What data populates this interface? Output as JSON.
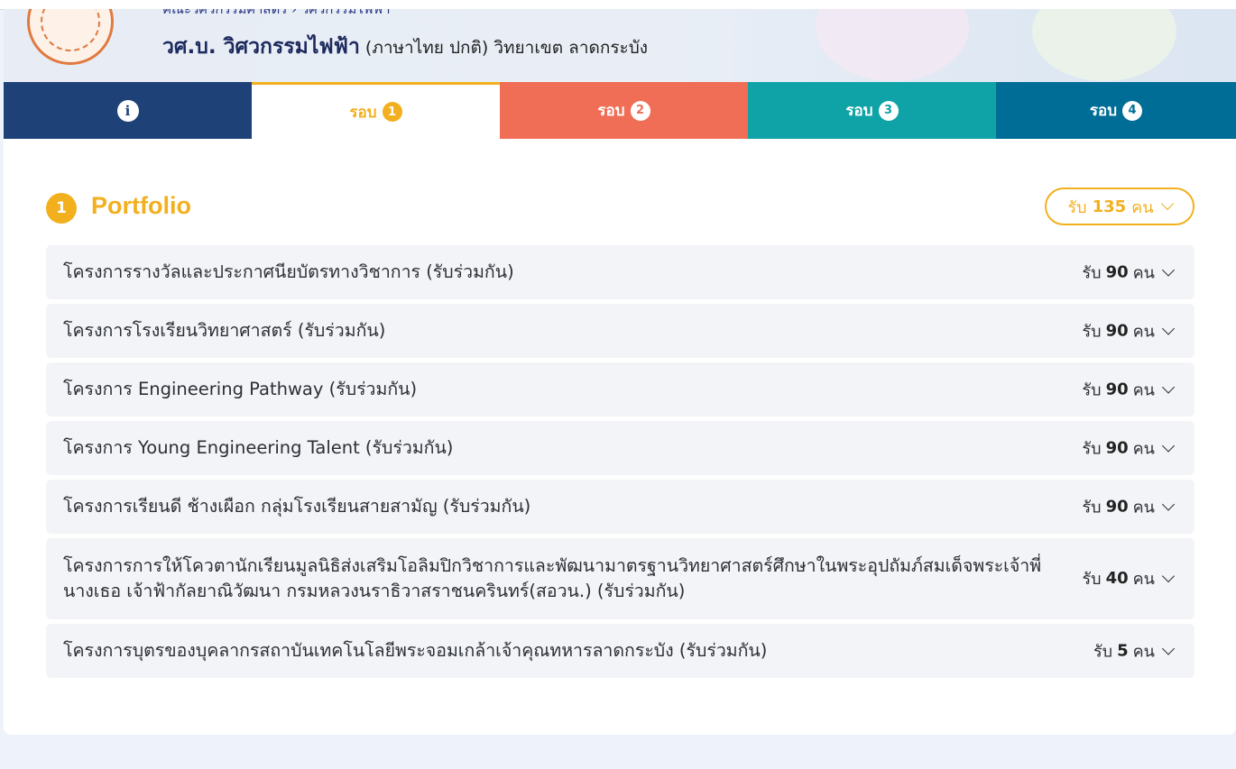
{
  "header": {
    "breadcrumb": "คณะวิศวกรรมศาสตร์ › วิศวกรรมไฟฟ้า",
    "program_bold": "วศ.บ. วิศวกรรมไฟฟ้า",
    "program_rest": " (ภาษาไทย ปกติ) วิทยาเขต ลาดกระบัง"
  },
  "tabs": [
    {
      "label": "",
      "icon": "info-icon"
    },
    {
      "label": "รอบ",
      "num": "1"
    },
    {
      "label": "รอบ",
      "num": "2"
    },
    {
      "label": "รอบ",
      "num": "3"
    },
    {
      "label": "รอบ",
      "num": "4"
    }
  ],
  "section": {
    "number": "1",
    "title": "Portfolio",
    "accept_prefix": "รับ",
    "accept_count": "135",
    "accept_suffix": "คน"
  },
  "projects": [
    {
      "name": "โครงการรางวัลและประกาศนียบัตรทางวิชาการ (รับร่วมกัน)",
      "prefix": "รับ",
      "count": "90",
      "suffix": "คน"
    },
    {
      "name": "โครงการโรงเรียนวิทยาศาสตร์ (รับร่วมกัน)",
      "prefix": "รับ",
      "count": "90",
      "suffix": "คน"
    },
    {
      "name": "โครงการ Engineering Pathway (รับร่วมกัน)",
      "prefix": "รับ",
      "count": "90",
      "suffix": "คน"
    },
    {
      "name": "โครงการ Young Engineering Talent (รับร่วมกัน)",
      "prefix": "รับ",
      "count": "90",
      "suffix": "คน"
    },
    {
      "name": "โครงการเรียนดี ช้างเผือก กลุ่มโรงเรียนสายสามัญ (รับร่วมกัน)",
      "prefix": "รับ",
      "count": "90",
      "suffix": "คน"
    },
    {
      "name": "โครงการการให้โควตานักเรียนมูลนิธิส่งเสริมโอลิมปิกวิชาการและพัฒนามาตรฐานวิทยาศาสตร์ศึกษาในพระอุปถัมภ์สมเด็จพระเจ้าพี่นางเธอ เจ้าฟ้ากัลยาณิวัฒนา กรมหลวงนราธิวาสราชนครินทร์(สอวน.) (รับร่วมกัน)",
      "prefix": "รับ",
      "count": "40",
      "suffix": "คน"
    },
    {
      "name": "โครงการบุตรของบุคลากรสถาบันเทคโนโลยีพระจอมเกล้าเจ้าคุณทหารลาดกระบัง (รับร่วมกัน)",
      "prefix": "รับ",
      "count": "5",
      "suffix": "คน"
    }
  ],
  "colors": {
    "info": "#1e4178",
    "round1": "#f2b01e",
    "round2": "#f06e56",
    "round3": "#0fa3a7",
    "round4": "#006d96"
  }
}
